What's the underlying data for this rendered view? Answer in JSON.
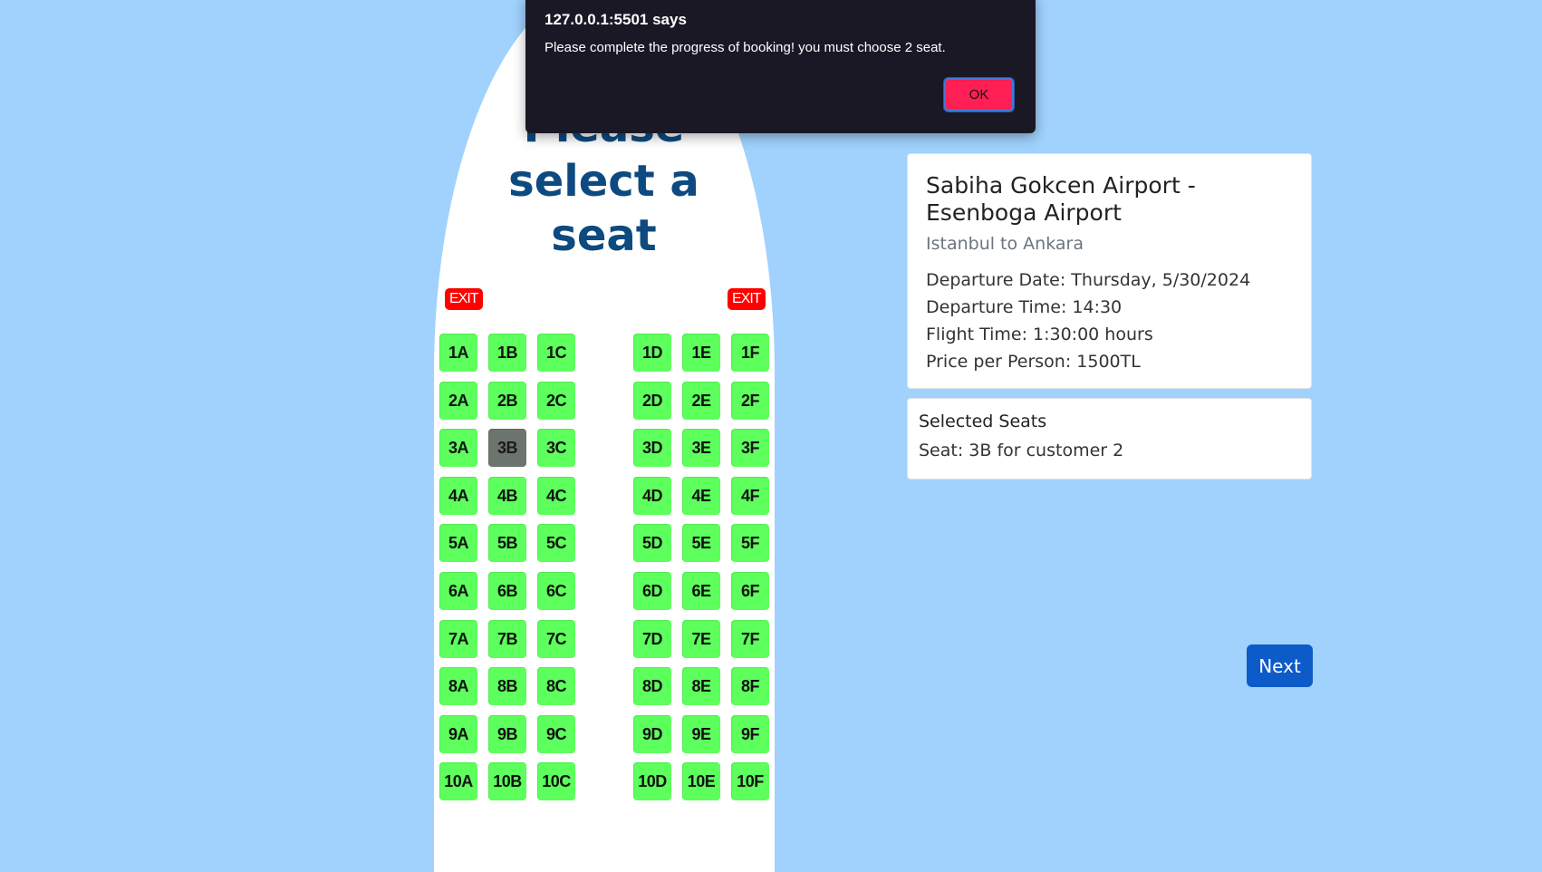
{
  "plane": {
    "title": "Please select a seat",
    "exit_left": "EXIT",
    "exit_right": "EXIT"
  },
  "seats": {
    "rows": [
      "1",
      "2",
      "3",
      "4",
      "5",
      "6",
      "7",
      "8",
      "9",
      "10"
    ],
    "letters_left": [
      "A",
      "B",
      "C"
    ],
    "letters_right": [
      "D",
      "E",
      "F"
    ],
    "taken": [
      "3B"
    ],
    "available_color": "#5cff5c",
    "taken_color": "#6c756d"
  },
  "flight": {
    "title": "Sabiha Gokcen Airport - Esenboga Airport",
    "subtitle": "Istanbul to Ankara",
    "departure_date": "Departure Date: Thursday, 5/30/2024",
    "departure_time": "Departure Time: 14:30",
    "flight_time": "Flight Time: 1:30:00 hours",
    "price": "Price per Person: 1500TL"
  },
  "selected_seats": {
    "heading": "Selected Seats",
    "items": [
      "Seat: 3B for customer 2"
    ]
  },
  "next_label": "Next",
  "dialog": {
    "origin": "127.0.0.1:5501 says",
    "message": "Please complete the progress of booking! you must choose 2 seat.",
    "ok_label": "OK"
  },
  "colors": {
    "background": "#a0d2fd",
    "title": "#0d4a7f",
    "exit": "#ff0000",
    "next_button": "#0d5ac9",
    "dialog_bg": "#1b1826",
    "dialog_ok": "#ff1f54"
  }
}
